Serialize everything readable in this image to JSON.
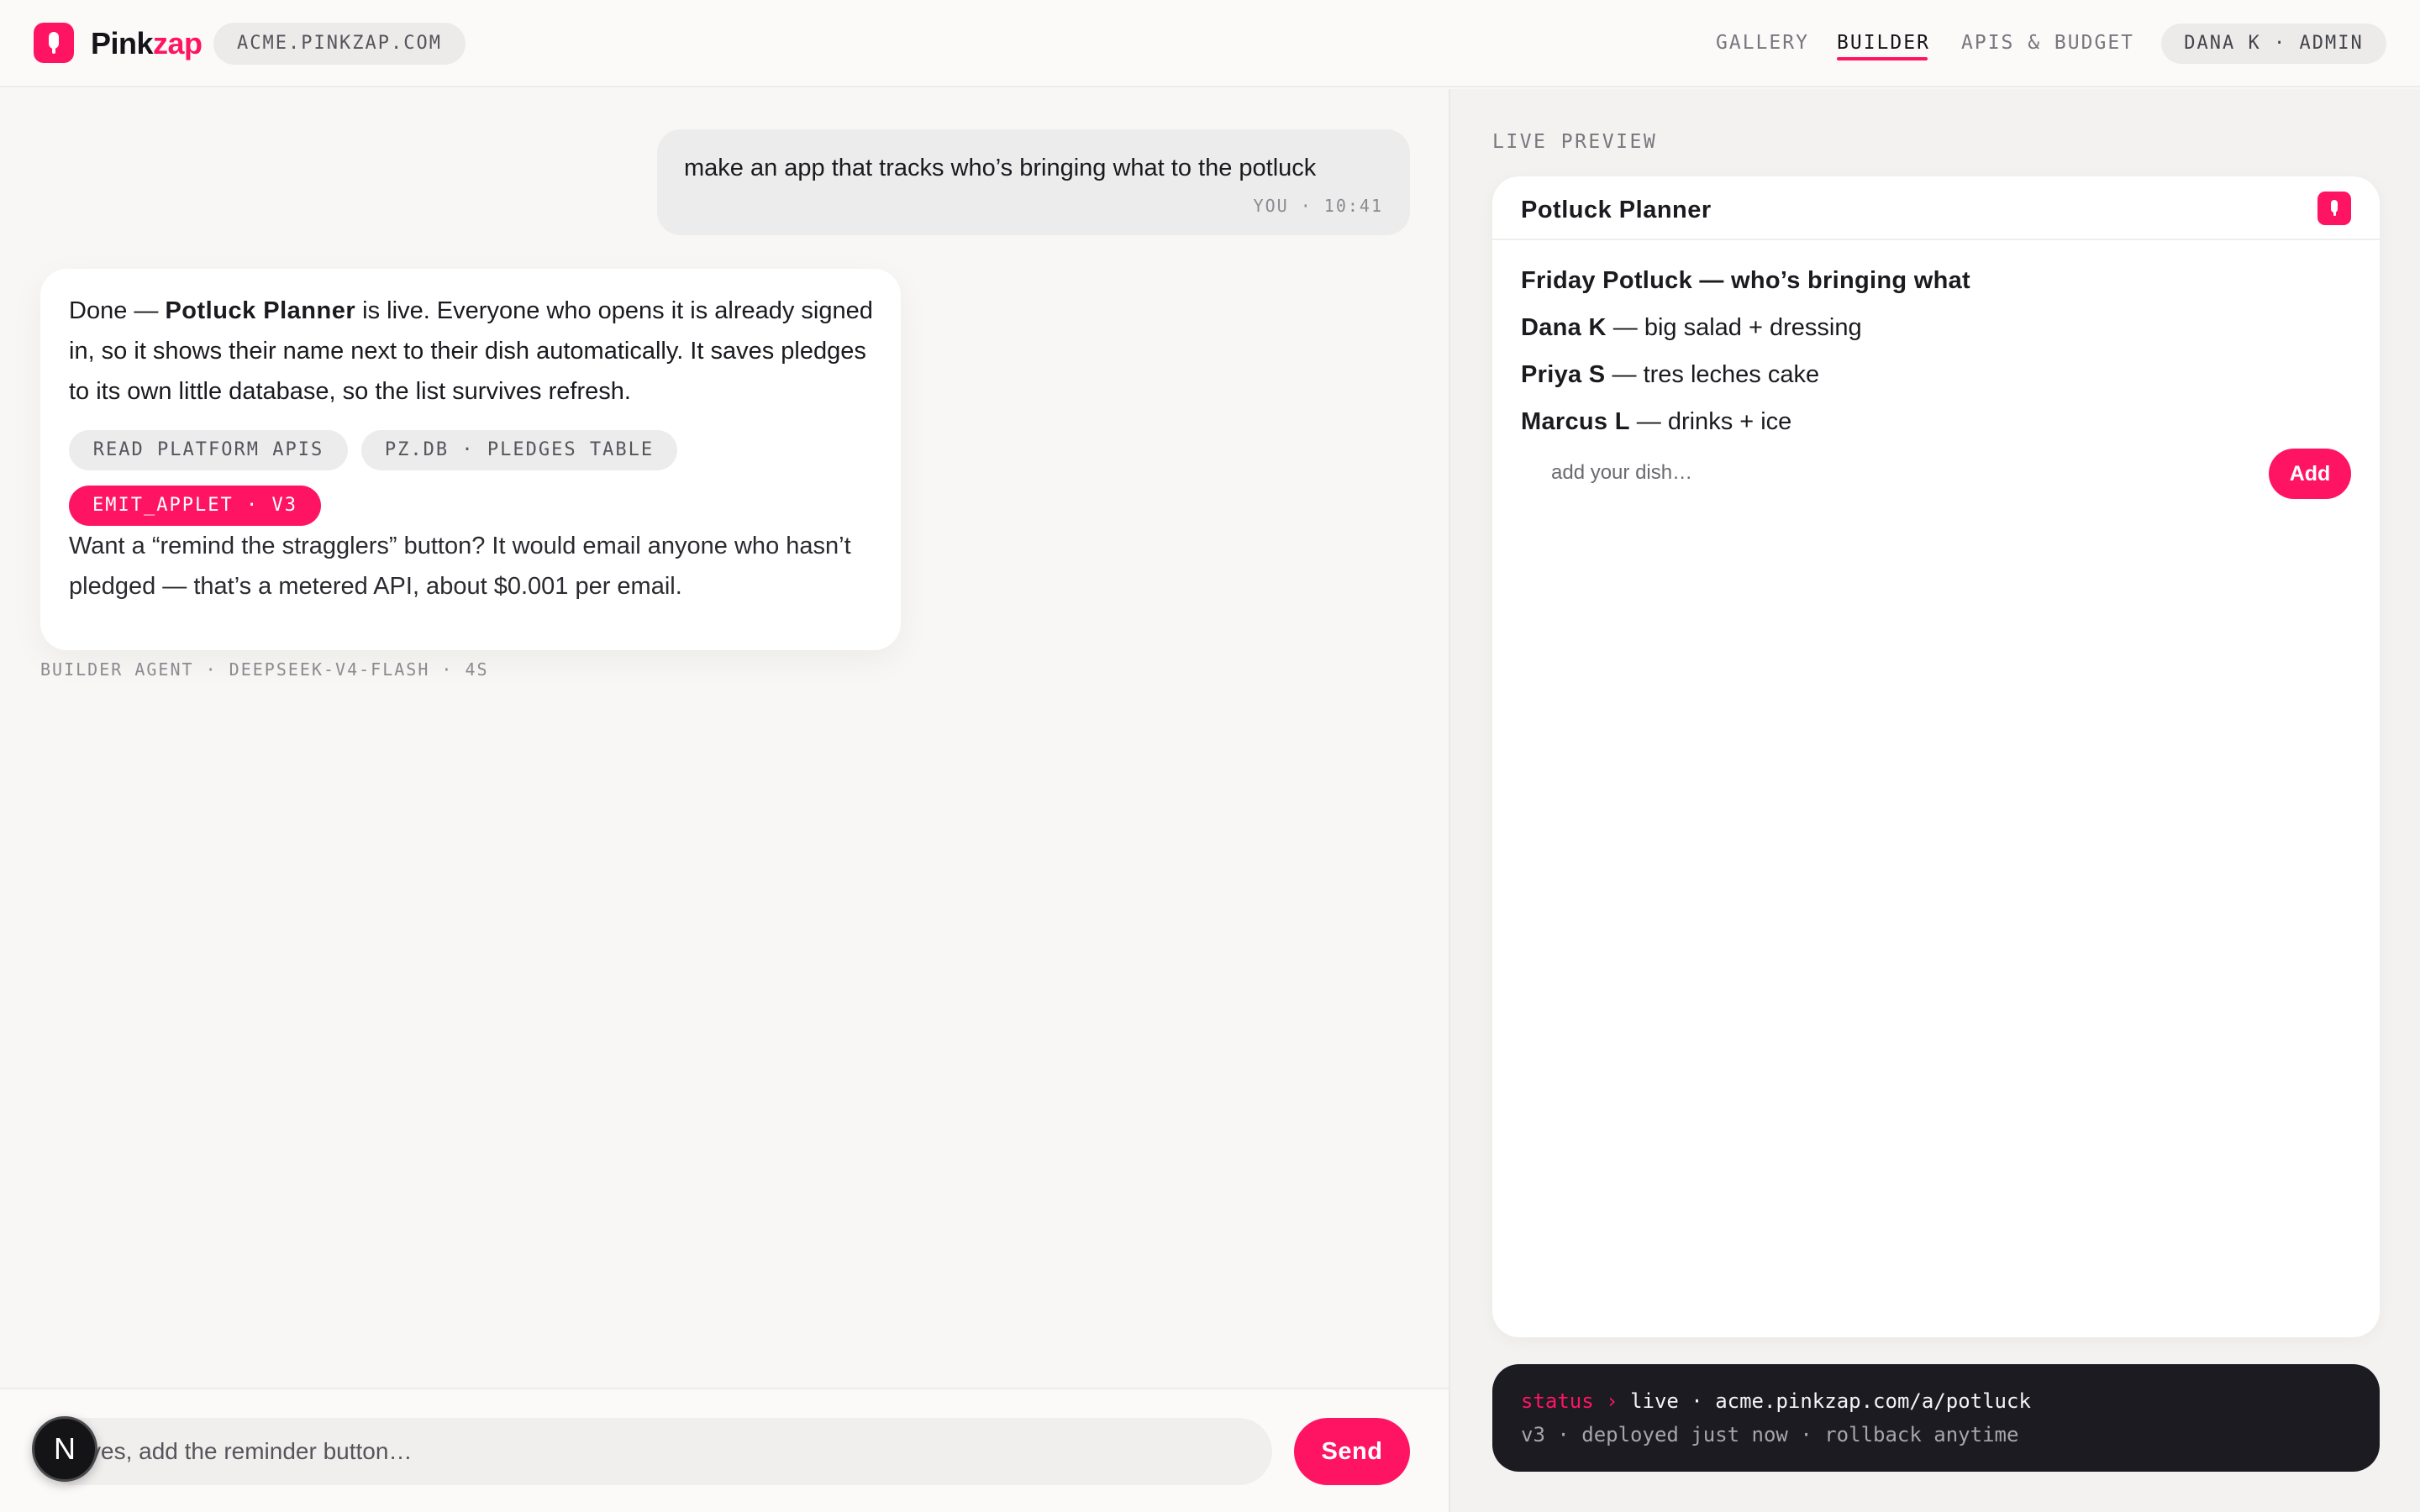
{
  "nav": {
    "brand_part1": "Pink",
    "brand_part2": "zap",
    "workspace_domain": "ACME.PINKZAP.COM",
    "links": [
      "GALLERY",
      "BUILDER",
      "APIS & BUDGET"
    ],
    "active_link": "BUILDER",
    "user": "DANA K · ADMIN"
  },
  "colors": {
    "accent": "#ff1464",
    "dark_card": "#1c1b21",
    "page_bg": "#f8f7f5"
  },
  "chat": {
    "user_message": {
      "text": "make an app that tracks who’s bringing what to the potluck",
      "meta": "YOU · 10:41"
    },
    "agent_message": {
      "p1_prefix": "Done — ",
      "p1_bold": "Potluck Planner",
      "p1_suffix": " is live. Everyone who opens it is already signed in, so it shows their name next to their dish automatically. It saves pledges to its own little database, so the list survives refresh.",
      "chips": [
        "READ PLATFORM APIS",
        "PZ.DB · PLEDGES TABLE"
      ],
      "highlight_chip": "EMIT_APPLET · V3",
      "p2": "Want a “remind the stragglers” button? It would email anyone who hasn’t pledged — that’s a metered API, about $0.001 per email.",
      "meta": "BUILDER AGENT · DEEPSEEK-V4-FLASH · 4S"
    },
    "composer": {
      "placeholder": "yes, add the reminder button…",
      "send_label": "Send"
    },
    "avatar_letter": "N"
  },
  "preview": {
    "label": "LIVE PREVIEW",
    "applet_title": "Potluck Planner",
    "heading": "Friday Potluck — who’s bringing what",
    "pledges": [
      {
        "name": "Dana K",
        "dish": " — big salad + dressing"
      },
      {
        "name": "Priya S",
        "dish": " — tres leches cake"
      },
      {
        "name": "Marcus L",
        "dish": " — drinks + ice"
      }
    ],
    "input_placeholder": "add your dish…",
    "add_label": "Add"
  },
  "status": {
    "key": "status",
    "arrow": " › ",
    "value": "live · acme.pinkzap.com/a/potluck",
    "detail": "v3 · deployed just now · rollback anytime"
  },
  "icons": {
    "logo": "pinkzap-logo-icon",
    "applet": "pinkzap-app-icon"
  }
}
